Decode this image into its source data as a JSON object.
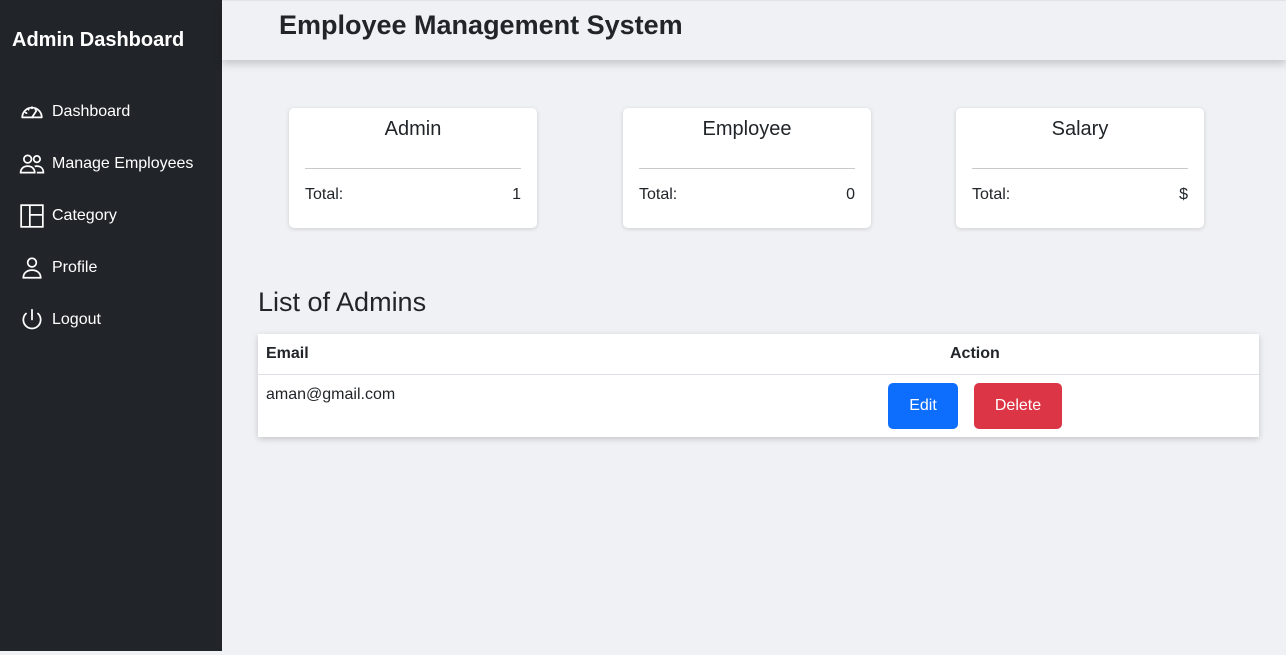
{
  "sidebar": {
    "title": "Admin Dashboard",
    "items": [
      {
        "label": "Dashboard",
        "icon": "speedometer-icon"
      },
      {
        "label": "Manage Employees",
        "icon": "people-icon"
      },
      {
        "label": "Category",
        "icon": "columns-icon"
      },
      {
        "label": "Profile",
        "icon": "person-icon"
      },
      {
        "label": "Logout",
        "icon": "power-icon"
      }
    ]
  },
  "header": {
    "title": "Employee Management System"
  },
  "cards": [
    {
      "title": "Admin",
      "total_label": "Total:",
      "total_value": "1"
    },
    {
      "title": "Employee",
      "total_label": "Total:",
      "total_value": "0"
    },
    {
      "title": "Salary",
      "total_label": "Total:",
      "total_value": "$"
    }
  ],
  "admins": {
    "title": "List of Admins",
    "columns": [
      "Email",
      "Action"
    ],
    "rows": [
      {
        "email": "aman@gmail.com",
        "edit_label": "Edit",
        "delete_label": "Delete"
      }
    ]
  },
  "colors": {
    "sidebar_bg": "#212529",
    "page_bg": "#f0f1f5",
    "edit_button": "#0d6efd",
    "delete_button": "#dc3545"
  }
}
